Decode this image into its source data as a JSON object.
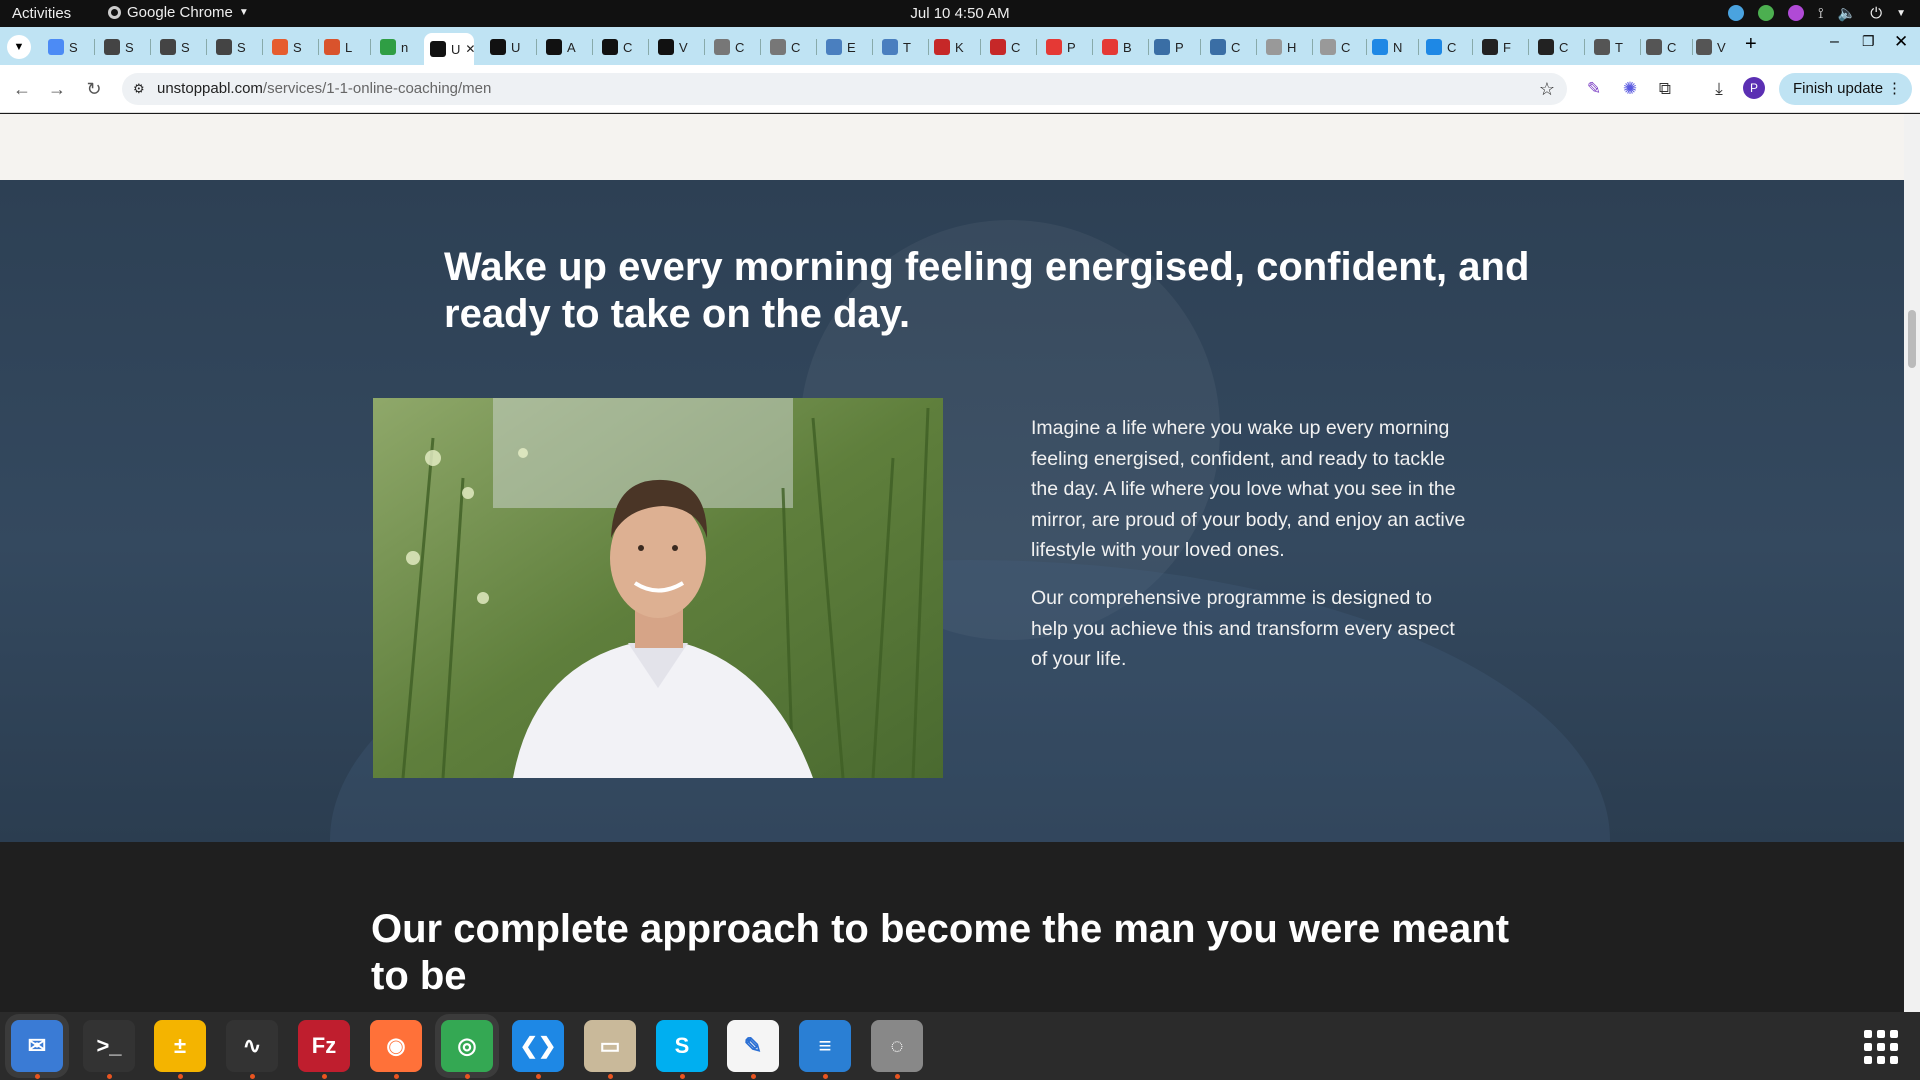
{
  "system_bar": {
    "activities": "Activities",
    "app_name": "Google Chrome",
    "clock": "Jul 10  4:50 AM"
  },
  "tabs": [
    {
      "label": "S",
      "color": "#4c8bf5"
    },
    {
      "label": "S",
      "color": "#444"
    },
    {
      "label": "S",
      "color": "#444"
    },
    {
      "label": "S",
      "color": "#444"
    },
    {
      "label": "S",
      "color": "#e65c2e"
    },
    {
      "label": "L",
      "color": "#d9532c"
    },
    {
      "label": "n",
      "color": "#2f9e44"
    },
    {
      "label": "U",
      "color": "#111",
      "active": true
    },
    {
      "label": "U",
      "color": "#111"
    },
    {
      "label": "A",
      "color": "#111"
    },
    {
      "label": "C",
      "color": "#111"
    },
    {
      "label": "V",
      "color": "#111"
    },
    {
      "label": "C",
      "color": "#777"
    },
    {
      "label": "C",
      "color": "#777"
    },
    {
      "label": "E",
      "color": "#4a7fbf"
    },
    {
      "label": "T",
      "color": "#4a7fbf"
    },
    {
      "label": "K",
      "color": "#c62828"
    },
    {
      "label": "C",
      "color": "#c62828"
    },
    {
      "label": "P",
      "color": "#e53935"
    },
    {
      "label": "B",
      "color": "#e53935"
    },
    {
      "label": "P",
      "color": "#3a6ea5"
    },
    {
      "label": "C",
      "color": "#3a6ea5"
    },
    {
      "label": "H",
      "color": "#999"
    },
    {
      "label": "C",
      "color": "#999"
    },
    {
      "label": "N",
      "color": "#1e88e5"
    },
    {
      "label": "C",
      "color": "#1e88e5"
    },
    {
      "label": "F",
      "color": "#222"
    },
    {
      "label": "C",
      "color": "#222"
    },
    {
      "label": "T",
      "color": "#555"
    },
    {
      "label": "C",
      "color": "#555"
    },
    {
      "label": "V",
      "color": "#555"
    }
  ],
  "address_bar": {
    "domain": "unstoppabl.com",
    "path": "/services/1-1-online-coaching/men"
  },
  "toolbar": {
    "finish_update": "Finish update",
    "profile_initial": "P"
  },
  "page": {
    "hero_heading": "Wake up every morning feeling energised, confident, and ready to take on the day.",
    "paragraph_1": "Imagine a life where you wake up every morning feeling energised, confident, and ready to tackle the day. A life where you love what you see in the mirror, are proud of your body, and enjoy an active lifestyle with your loved ones.",
    "paragraph_2": "Our comprehensive programme is designed to help you achieve this and transform every aspect of your life.",
    "section_heading": "Our complete approach to become the man you were meant to be"
  },
  "dock": [
    {
      "name": "thunderbird",
      "color": "#3a7bd5",
      "glyph": "✉"
    },
    {
      "name": "terminal",
      "color": "#333",
      "glyph": ">_"
    },
    {
      "name": "calculator",
      "color": "#f4b400",
      "glyph": "±"
    },
    {
      "name": "system-monitor",
      "color": "#333",
      "glyph": "∿"
    },
    {
      "name": "filezilla",
      "color": "#bf1e2e",
      "glyph": "Fz"
    },
    {
      "name": "firefox",
      "color": "#ff7139",
      "glyph": "◉"
    },
    {
      "name": "chrome",
      "color": "#34a853",
      "glyph": "◎"
    },
    {
      "name": "vscode",
      "color": "#1e88e5",
      "glyph": "❮❯"
    },
    {
      "name": "files",
      "color": "#c9b99a",
      "glyph": "▭"
    },
    {
      "name": "skype",
      "color": "#00aff0",
      "glyph": "S"
    },
    {
      "name": "text-editor",
      "color": "#f5f5f5",
      "glyph": "✎"
    },
    {
      "name": "writer",
      "color": "#2a7fd4",
      "glyph": "≡"
    },
    {
      "name": "disk-tool",
      "color": "#888",
      "glyph": "◌"
    }
  ]
}
